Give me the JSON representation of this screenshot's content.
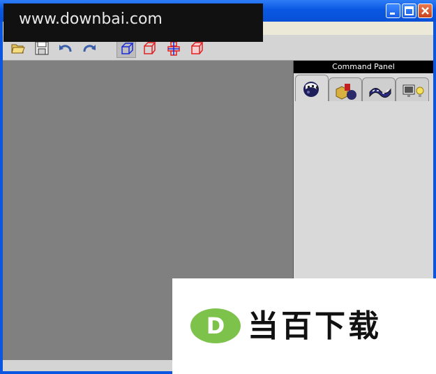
{
  "window": {
    "controls": {
      "minimize_icon": "minimize-icon",
      "maximize_icon": "maximize-icon",
      "close_icon": "close-icon"
    }
  },
  "toolbar": {
    "tools": [
      "open-folder-icon",
      "save-disk-icon",
      "undo-icon",
      "redo-icon",
      "view-perspective-icon",
      "view-front-icon",
      "view-top-icon",
      "view-side-icon"
    ]
  },
  "command_panel": {
    "title": "Command Panel",
    "tabs": [
      "material-sphere-icon",
      "primitives-icon",
      "modifier-surface-icon",
      "render-light-icon"
    ]
  },
  "watermarks": {
    "site_url": "www.downbai.com",
    "brand_name": "当百下载",
    "brand_letter": "D"
  },
  "colors": {
    "titlebar": "#0a58e2",
    "viewport": "#808080",
    "panel": "#d9d9d9",
    "brand_green": "#7dc24a"
  }
}
